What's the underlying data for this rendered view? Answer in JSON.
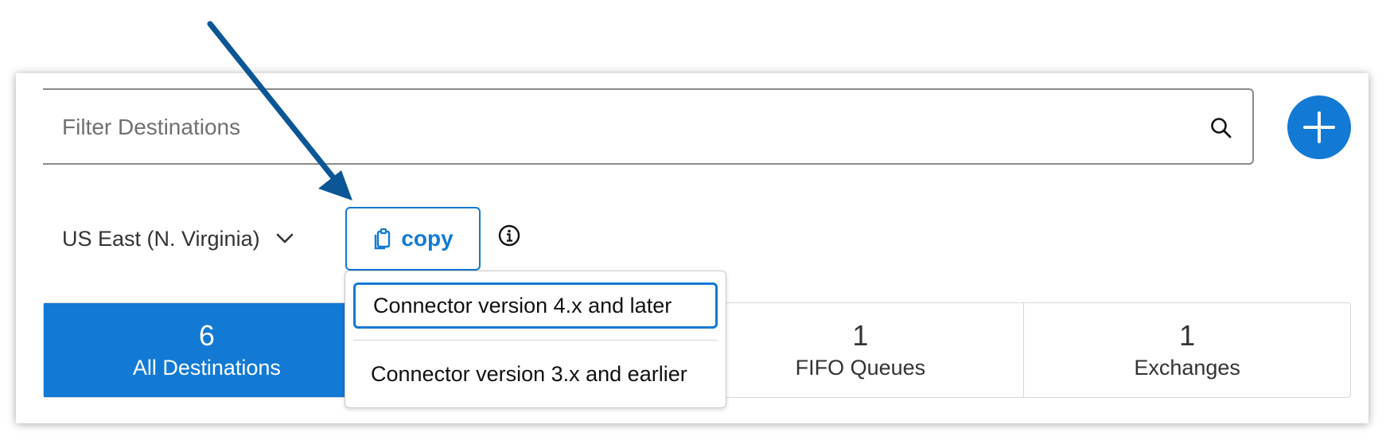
{
  "search": {
    "placeholder": "Filter Destinations",
    "value": ""
  },
  "region": {
    "label": "US East (N. Virginia)"
  },
  "copy_button": {
    "label": "copy"
  },
  "dropdown": {
    "items": [
      {
        "label": "Connector version 4.x and later"
      },
      {
        "label": "Connector version 3.x and earlier"
      }
    ]
  },
  "stats": [
    {
      "count": "6",
      "label": "All Destinations"
    },
    {
      "count": "",
      "label": ""
    },
    {
      "count": "1",
      "label": "FIFO Queues"
    },
    {
      "count": "1",
      "label": "Exchanges"
    }
  ],
  "colors": {
    "accent": "#1279d4",
    "annotation_arrow": "#0d5696"
  },
  "icons": [
    "search-icon",
    "plus-icon",
    "chevron-down-icon",
    "clipboard-icon",
    "info-icon",
    "arrow-annotation"
  ]
}
